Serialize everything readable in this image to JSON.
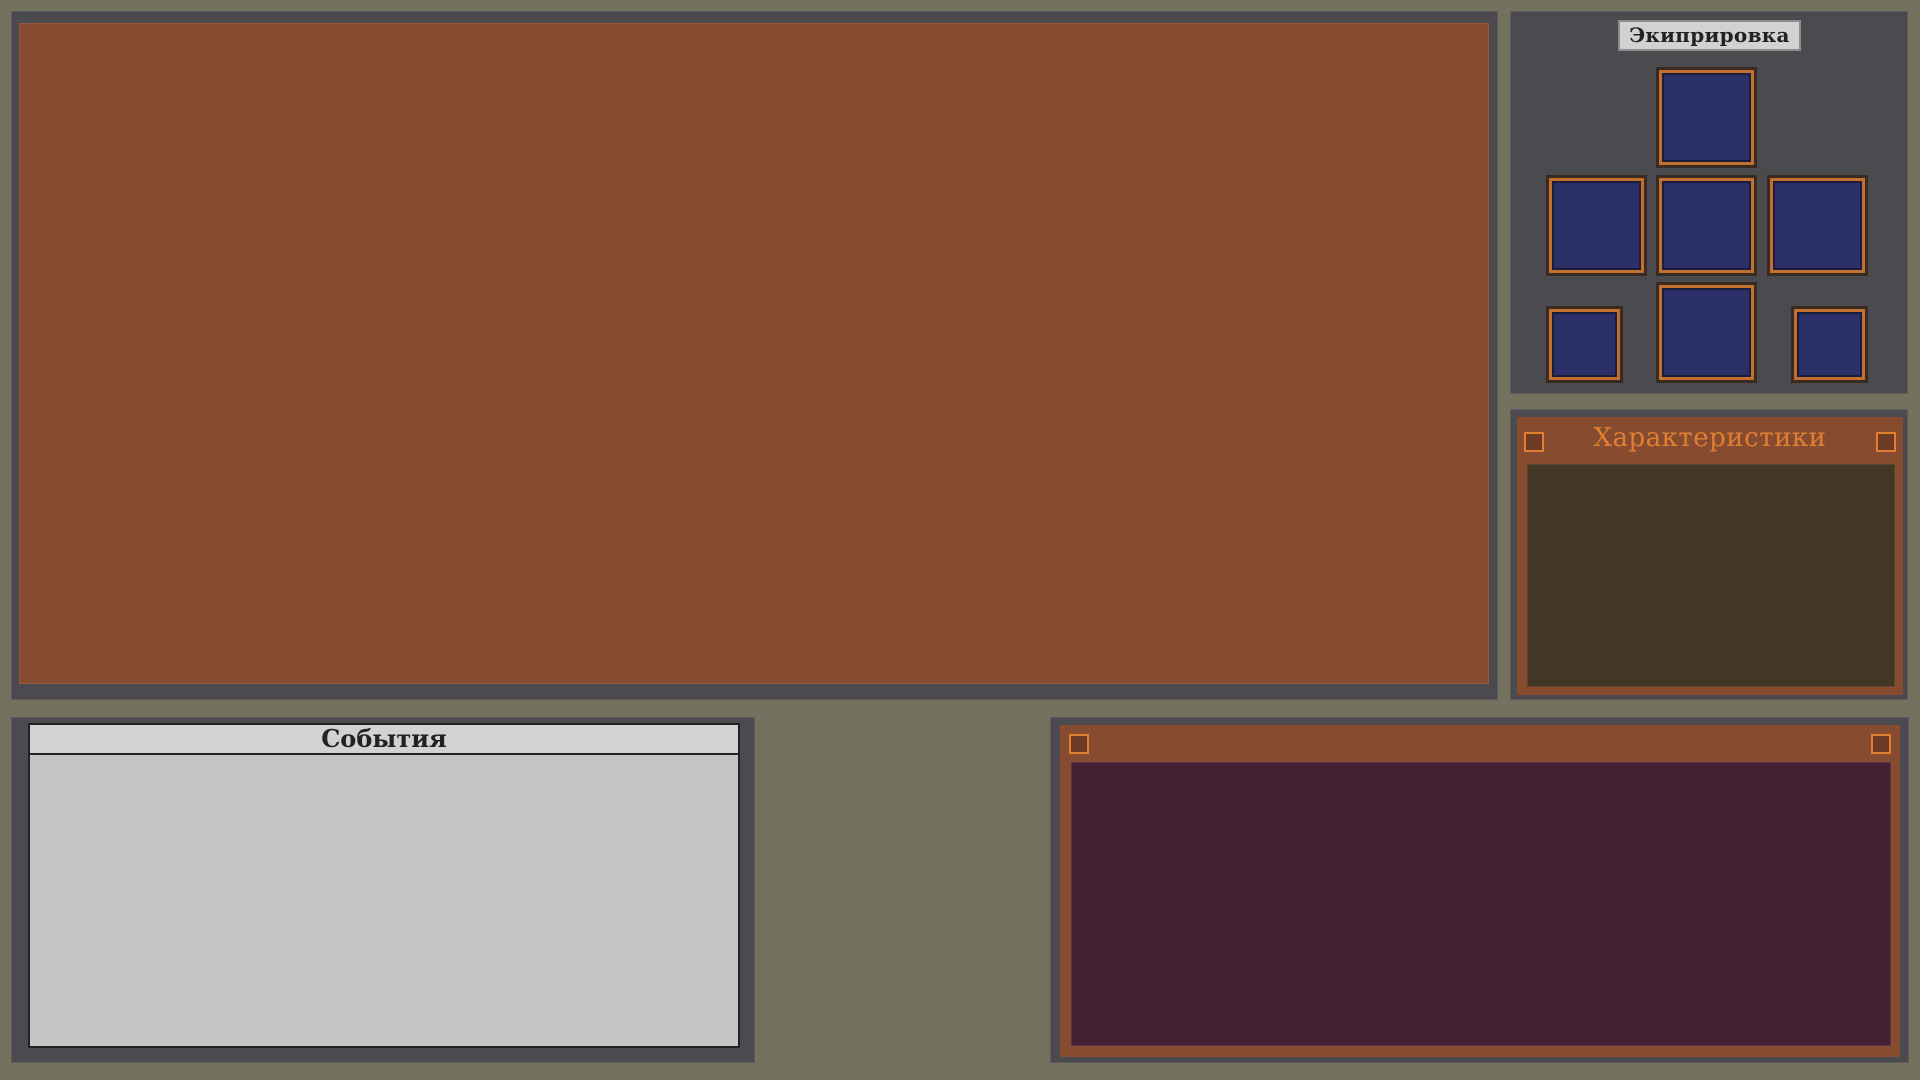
{
  "equipment": {
    "title": "Экиприровка",
    "slot_count": 7
  },
  "stats": {
    "title": "Характеристики"
  },
  "events": {
    "title": "События"
  },
  "colors": {
    "background": "#74725f",
    "panel": "#4b4a4e",
    "view": "#874b30",
    "slot_fill": "#2b3068",
    "slot_border": "#c2702f",
    "stats_title": "#e07f32",
    "stats_body": "#423624",
    "events_body": "#c4c4c4",
    "dialog_body": "#432133"
  }
}
